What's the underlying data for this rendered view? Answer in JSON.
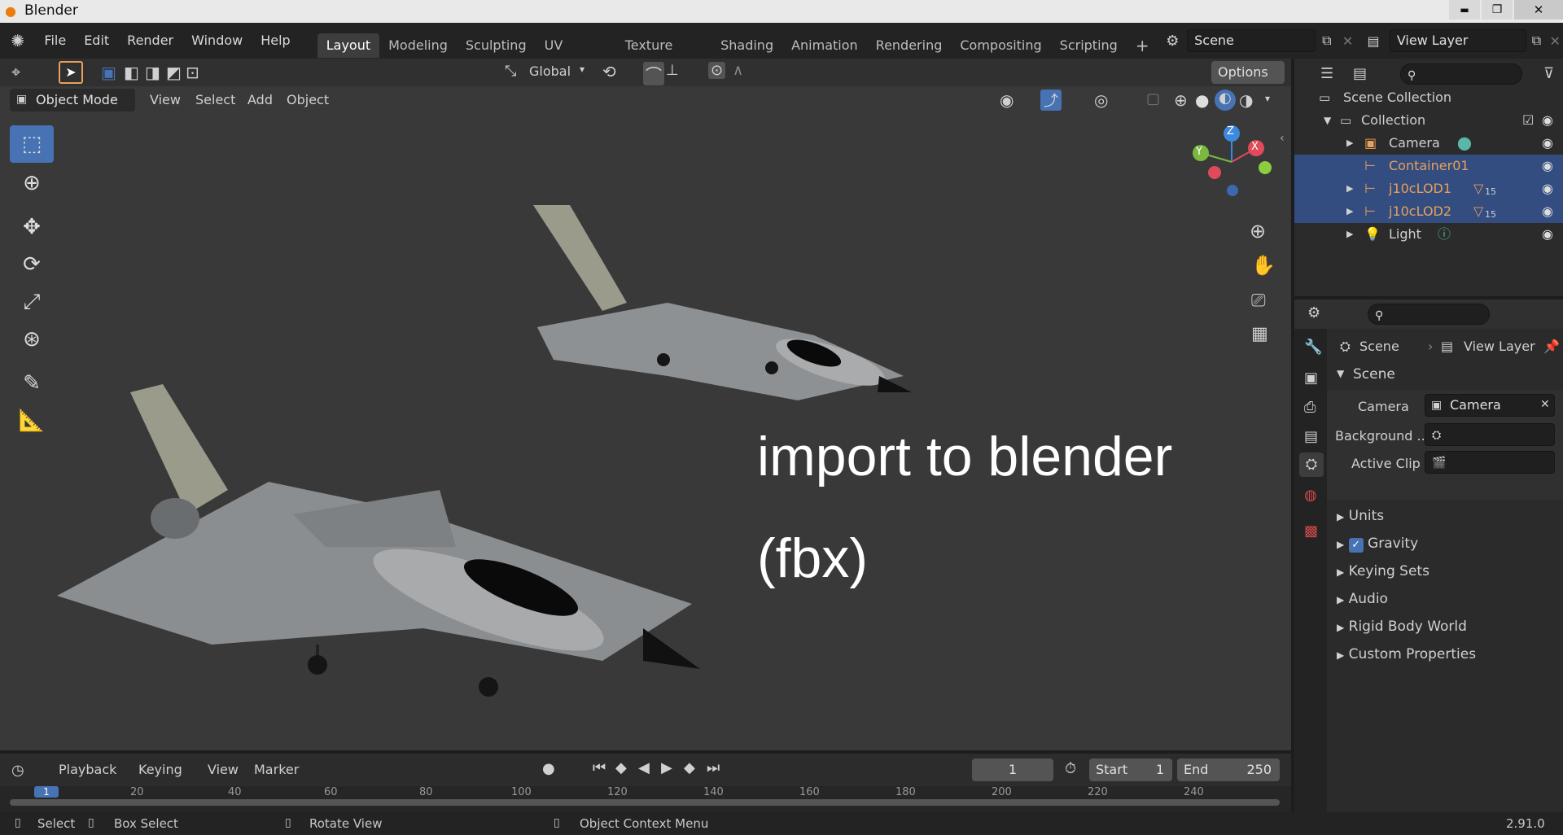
{
  "window": {
    "title": "Blender",
    "controls": {
      "minimize": "▬",
      "maximize": "❐",
      "close": "✕"
    }
  },
  "menu": [
    "File",
    "Edit",
    "Render",
    "Window",
    "Help"
  ],
  "workspaces": [
    "Layout",
    "Modeling",
    "Sculpting",
    "UV Editing",
    "Texture Paint",
    "Shading",
    "Animation",
    "Rendering",
    "Compositing",
    "Scripting"
  ],
  "active_workspace": "Layout",
  "scene_field": "Scene",
  "view_layer_field": "View Layer",
  "viewport": {
    "transform_orientation": "Global",
    "options_label": "Options",
    "mode": "Object Mode",
    "header_menu": [
      "View",
      "Select",
      "Add",
      "Object"
    ],
    "overlay_text_line1": "import to blender",
    "overlay_text_line2": "(fbx)",
    "gizmo": {
      "x": "X",
      "y": "Y",
      "z": "Z"
    }
  },
  "timeline": {
    "menu": [
      "Playback",
      "Keying",
      "View",
      "Marker"
    ],
    "current_frame": "1",
    "start_label": "Start",
    "start_value": "1",
    "end_label": "End",
    "end_value": "250",
    "ruler": [
      "1",
      "20",
      "40",
      "60",
      "80",
      "100",
      "120",
      "140",
      "160",
      "180",
      "200",
      "220",
      "240"
    ]
  },
  "outliner": {
    "root": "Scene Collection",
    "collection": "Collection",
    "items": [
      {
        "label": "Camera",
        "selected": false,
        "color": "#d8d8d8"
      },
      {
        "label": "Container01",
        "selected": true,
        "color": "#e8a05a"
      },
      {
        "label": "j10cLOD1",
        "selected": true,
        "color": "#e8a05a",
        "modifier": "15"
      },
      {
        "label": "j10cLOD2",
        "selected": true,
        "color": "#e8a05a",
        "modifier": "15"
      },
      {
        "label": "Light",
        "selected": false,
        "color": "#d8d8d8"
      }
    ]
  },
  "properties": {
    "breadcrumb_scene": "Scene",
    "breadcrumb_view_layer": "View Layer",
    "section_title": "Scene",
    "camera_label": "Camera",
    "camera_value": "Camera",
    "background_label": "Background ...",
    "active_clip_label": "Active Clip",
    "panels": [
      "Units",
      "Gravity",
      "Keying Sets",
      "Audio",
      "Rigid Body World",
      "Custom Properties"
    ],
    "gravity_checked": true
  },
  "status": {
    "select": "Select",
    "box_select": "Box Select",
    "rotate_view": "Rotate View",
    "context_menu": "Object Context Menu",
    "version": "2.91.0"
  },
  "colors": {
    "accent": "#4772b3",
    "selection": "#334d80",
    "object_orange": "#e8a05a"
  }
}
